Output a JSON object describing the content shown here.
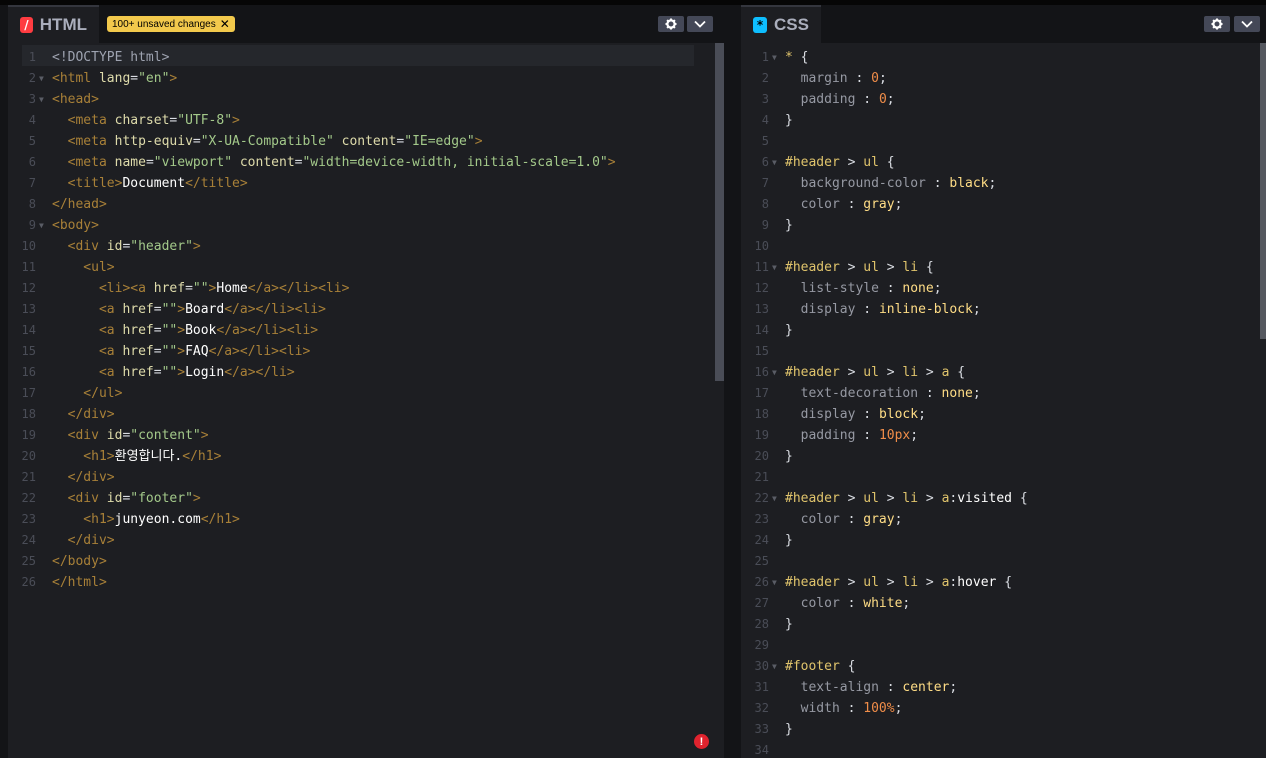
{
  "html_panel": {
    "title": "HTML",
    "icon": "html-icon",
    "icon_color": "#ff3c41",
    "unsaved_badge": "100+ unsaved changes",
    "badge_close": "✕",
    "lines": [
      [
        [
          "t-doc",
          "<!DOCTYPE html>"
        ]
      ],
      [
        [
          "t-tag",
          "<html "
        ],
        [
          "t-attr",
          "lang"
        ],
        [
          "t-punc",
          "="
        ],
        [
          "t-str",
          "\"en\""
        ],
        [
          "t-tag",
          ">"
        ]
      ],
      [
        [
          "t-tag",
          "<head>"
        ]
      ],
      [
        [
          "t-tag",
          "  <meta "
        ],
        [
          "t-attr",
          "charset"
        ],
        [
          "t-punc",
          "="
        ],
        [
          "t-str",
          "\"UTF-8\""
        ],
        [
          "t-tag",
          ">"
        ]
      ],
      [
        [
          "t-tag",
          "  <meta "
        ],
        [
          "t-attr",
          "http-equiv"
        ],
        [
          "t-punc",
          "="
        ],
        [
          "t-str",
          "\"X-UA-Compatible\" "
        ],
        [
          "t-attr",
          "content"
        ],
        [
          "t-punc",
          "="
        ],
        [
          "t-str",
          "\"IE=edge\""
        ],
        [
          "t-tag",
          ">"
        ]
      ],
      [
        [
          "t-tag",
          "  <meta "
        ],
        [
          "t-attr",
          "name"
        ],
        [
          "t-punc",
          "="
        ],
        [
          "t-str",
          "\"viewport\" "
        ],
        [
          "t-attr",
          "content"
        ],
        [
          "t-punc",
          "="
        ],
        [
          "t-str",
          "\"width=device-width, initial-scale=1.0\""
        ],
        [
          "t-tag",
          ">"
        ]
      ],
      [
        [
          "t-tag",
          "  <title>"
        ],
        [
          "t-txt",
          "Document"
        ],
        [
          "t-tag",
          "</title>"
        ]
      ],
      [
        [
          "t-tag",
          "</head>"
        ]
      ],
      [
        [
          "t-tag",
          "<body>"
        ]
      ],
      [
        [
          "t-tag",
          "  <div "
        ],
        [
          "t-attr",
          "id"
        ],
        [
          "t-punc",
          "="
        ],
        [
          "t-str",
          "\"header\""
        ],
        [
          "t-tag",
          ">"
        ]
      ],
      [
        [
          "t-tag",
          "    <ul>"
        ]
      ],
      [
        [
          "t-tag",
          "      <li><a "
        ],
        [
          "t-attr",
          "href"
        ],
        [
          "t-punc",
          "="
        ],
        [
          "t-str",
          "\"\""
        ],
        [
          "t-tag",
          ">"
        ],
        [
          "t-txt",
          "Home"
        ],
        [
          "t-tag",
          "</a></li><li>"
        ]
      ],
      [
        [
          "t-tag",
          "      <a "
        ],
        [
          "t-attr",
          "href"
        ],
        [
          "t-punc",
          "="
        ],
        [
          "t-str",
          "\"\""
        ],
        [
          "t-tag",
          ">"
        ],
        [
          "t-txt",
          "Board"
        ],
        [
          "t-tag",
          "</a></li><li>"
        ]
      ],
      [
        [
          "t-tag",
          "      <a "
        ],
        [
          "t-attr",
          "href"
        ],
        [
          "t-punc",
          "="
        ],
        [
          "t-str",
          "\"\""
        ],
        [
          "t-tag",
          ">"
        ],
        [
          "t-txt",
          "Book"
        ],
        [
          "t-tag",
          "</a></li><li>"
        ]
      ],
      [
        [
          "t-tag",
          "      <a "
        ],
        [
          "t-attr",
          "href"
        ],
        [
          "t-punc",
          "="
        ],
        [
          "t-str",
          "\"\""
        ],
        [
          "t-tag",
          ">"
        ],
        [
          "t-txt",
          "FAQ"
        ],
        [
          "t-tag",
          "</a></li><li>"
        ]
      ],
      [
        [
          "t-tag",
          "      <a "
        ],
        [
          "t-attr",
          "href"
        ],
        [
          "t-punc",
          "="
        ],
        [
          "t-str",
          "\"\""
        ],
        [
          "t-tag",
          ">"
        ],
        [
          "t-txt",
          "Login"
        ],
        [
          "t-tag",
          "</a></li>"
        ]
      ],
      [
        [
          "t-tag",
          "    </ul>"
        ]
      ],
      [
        [
          "t-tag",
          "  </div>"
        ]
      ],
      [
        [
          "t-tag",
          "  <div "
        ],
        [
          "t-attr",
          "id"
        ],
        [
          "t-punc",
          "="
        ],
        [
          "t-str",
          "\"content\""
        ],
        [
          "t-tag",
          ">"
        ]
      ],
      [
        [
          "t-tag",
          "    <h1>"
        ],
        [
          "t-txt",
          "환영합니다."
        ],
        [
          "t-tag",
          "</h1>"
        ]
      ],
      [
        [
          "t-tag",
          "  </div>"
        ]
      ],
      [
        [
          "t-tag",
          "  <div "
        ],
        [
          "t-attr",
          "id"
        ],
        [
          "t-punc",
          "="
        ],
        [
          "t-str",
          "\"footer\""
        ],
        [
          "t-tag",
          ">"
        ]
      ],
      [
        [
          "t-tag",
          "    <h1>"
        ],
        [
          "t-txt",
          "junyeon.com"
        ],
        [
          "t-tag",
          "</h1>"
        ]
      ],
      [
        [
          "t-tag",
          "  </div>"
        ]
      ],
      [
        [
          "t-tag",
          "</body>"
        ]
      ],
      [
        [
          "t-tag",
          "</html>"
        ]
      ]
    ],
    "folds": [
      2,
      3,
      9
    ]
  },
  "css_panel": {
    "title": "CSS",
    "icon": "css-icon",
    "icon_color": "#0ebeff",
    "lines": [
      [
        [
          "t-sel",
          "* "
        ],
        [
          "t-punc",
          "{"
        ]
      ],
      [
        [
          "t-prop",
          "  margin "
        ],
        [
          "t-punc",
          ": "
        ],
        [
          "t-num",
          "0"
        ],
        [
          "t-punc",
          ";"
        ]
      ],
      [
        [
          "t-prop",
          "  padding "
        ],
        [
          "t-punc",
          ": "
        ],
        [
          "t-num",
          "0"
        ],
        [
          "t-punc",
          ";"
        ]
      ],
      [
        [
          "t-punc",
          "}"
        ]
      ],
      [],
      [
        [
          "t-sel",
          "#header "
        ],
        [
          "t-punc",
          "> "
        ],
        [
          "t-sel",
          "ul "
        ],
        [
          "t-punc",
          "{"
        ]
      ],
      [
        [
          "t-prop",
          "  background-color "
        ],
        [
          "t-punc",
          ": "
        ],
        [
          "t-val",
          "black"
        ],
        [
          "t-punc",
          ";"
        ]
      ],
      [
        [
          "t-prop",
          "  color "
        ],
        [
          "t-punc",
          ": "
        ],
        [
          "t-val",
          "gray"
        ],
        [
          "t-punc",
          ";"
        ]
      ],
      [
        [
          "t-punc",
          "}"
        ]
      ],
      [],
      [
        [
          "t-sel",
          "#header "
        ],
        [
          "t-punc",
          "> "
        ],
        [
          "t-sel",
          "ul "
        ],
        [
          "t-punc",
          "> "
        ],
        [
          "t-sel",
          "li "
        ],
        [
          "t-punc",
          "{"
        ]
      ],
      [
        [
          "t-prop",
          "  list-style "
        ],
        [
          "t-punc",
          ": "
        ],
        [
          "t-val",
          "none"
        ],
        [
          "t-punc",
          ";"
        ]
      ],
      [
        [
          "t-prop",
          "  display "
        ],
        [
          "t-punc",
          ": "
        ],
        [
          "t-val",
          "inline-block"
        ],
        [
          "t-punc",
          ";"
        ]
      ],
      [
        [
          "t-punc",
          "}"
        ]
      ],
      [],
      [
        [
          "t-sel",
          "#header "
        ],
        [
          "t-punc",
          "> "
        ],
        [
          "t-sel",
          "ul "
        ],
        [
          "t-punc",
          "> "
        ],
        [
          "t-sel",
          "li "
        ],
        [
          "t-punc",
          "> "
        ],
        [
          "t-sel",
          "a "
        ],
        [
          "t-punc",
          "{"
        ]
      ],
      [
        [
          "t-prop",
          "  text-decoration "
        ],
        [
          "t-punc",
          ": "
        ],
        [
          "t-val",
          "none"
        ],
        [
          "t-punc",
          ";"
        ]
      ],
      [
        [
          "t-prop",
          "  display "
        ],
        [
          "t-punc",
          ": "
        ],
        [
          "t-val",
          "block"
        ],
        [
          "t-punc",
          ";"
        ]
      ],
      [
        [
          "t-prop",
          "  padding "
        ],
        [
          "t-punc",
          ": "
        ],
        [
          "t-num",
          "10px"
        ],
        [
          "t-punc",
          ";"
        ]
      ],
      [
        [
          "t-punc",
          "}"
        ]
      ],
      [],
      [
        [
          "t-sel",
          "#header "
        ],
        [
          "t-punc",
          "> "
        ],
        [
          "t-sel",
          "ul "
        ],
        [
          "t-punc",
          "> "
        ],
        [
          "t-sel",
          "li "
        ],
        [
          "t-punc",
          "> "
        ],
        [
          "t-sel",
          "a"
        ],
        [
          "t-punc",
          ":"
        ],
        [
          "t-txt",
          "visited "
        ],
        [
          "t-punc",
          "{"
        ]
      ],
      [
        [
          "t-prop",
          "  color "
        ],
        [
          "t-punc",
          ": "
        ],
        [
          "t-val",
          "gray"
        ],
        [
          "t-punc",
          ";"
        ]
      ],
      [
        [
          "t-punc",
          "}"
        ]
      ],
      [],
      [
        [
          "t-sel",
          "#header "
        ],
        [
          "t-punc",
          "> "
        ],
        [
          "t-sel",
          "ul "
        ],
        [
          "t-punc",
          "> "
        ],
        [
          "t-sel",
          "li "
        ],
        [
          "t-punc",
          "> "
        ],
        [
          "t-sel",
          "a"
        ],
        [
          "t-punc",
          ":"
        ],
        [
          "t-txt",
          "hover "
        ],
        [
          "t-punc",
          "{"
        ]
      ],
      [
        [
          "t-prop",
          "  color "
        ],
        [
          "t-punc",
          ": "
        ],
        [
          "t-val",
          "white"
        ],
        [
          "t-punc",
          ";"
        ]
      ],
      [
        [
          "t-punc",
          "}"
        ]
      ],
      [],
      [
        [
          "t-sel",
          "#footer "
        ],
        [
          "t-punc",
          "{"
        ]
      ],
      [
        [
          "t-prop",
          "  text-align "
        ],
        [
          "t-punc",
          ": "
        ],
        [
          "t-val",
          "center"
        ],
        [
          "t-punc",
          ";"
        ]
      ],
      [
        [
          "t-prop",
          "  width "
        ],
        [
          "t-punc",
          ": "
        ],
        [
          "t-num",
          "100%"
        ],
        [
          "t-punc",
          ";"
        ]
      ],
      [
        [
          "t-punc",
          "}"
        ]
      ],
      []
    ],
    "folds": [
      1,
      6,
      11,
      16,
      22,
      26,
      30
    ]
  },
  "error_indicator": "!"
}
